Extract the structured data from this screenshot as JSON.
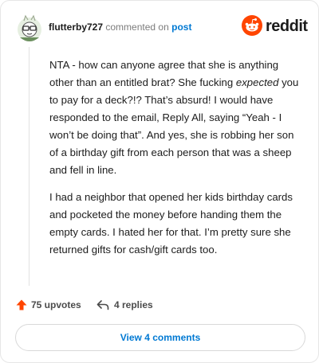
{
  "comment": {
    "username": "flutterby727",
    "action_text": "commented on",
    "post_link": "post",
    "paragraphs": {
      "p1": {
        "a": "NTA - how can anyone agree that she is anything other than an entitled brat? She fucking ",
        "em": "expected",
        "b": " you to pay for a deck?!? That’s absurd! I would have responded to the email, Reply All, saying “Yeah - I won’t be doing that”. And yes, she is robbing her son of a birthday gift from each person that was a sheep and fell in line."
      },
      "p2": "I had a neighbor that opened her kids birthday cards and pocketed the money before handing them the empty cards. I hated her for that. I’m pretty sure she returned gifts for cash/gift cards too."
    }
  },
  "brand": {
    "name": "reddit",
    "accent": "#ff4500"
  },
  "actions": {
    "upvotes": "75 upvotes",
    "replies": "4 replies",
    "upvote_icon": "arrow-up-icon",
    "reply_icon": "reply-arrow-icon"
  },
  "footer": {
    "view_comments_label": "View 4 comments"
  },
  "colors": {
    "link": "#0079d3",
    "text": "#1c1c1c",
    "muted": "#7c7c7c",
    "upvote": "#ff4500"
  }
}
